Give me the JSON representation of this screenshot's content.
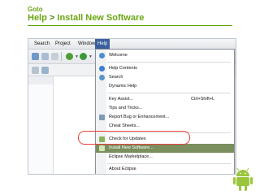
{
  "slide": {
    "kicker": "Goto",
    "title_part1": "Help",
    "title_arrow": ">",
    "title_part2": "Install New Software"
  },
  "menubar": {
    "items": [
      "Search",
      "Project",
      "Window",
      "Help"
    ]
  },
  "help_menu": {
    "items": [
      {
        "label": "Welcome",
        "icon": "welcome-icon"
      },
      {
        "label": "Help Contents",
        "icon": "help-icon"
      },
      {
        "label": "Search",
        "icon": "search-icon"
      },
      {
        "label": "Dynamic Help"
      },
      {
        "label": "Key Assist...",
        "accelerator": "Ctrl+Shift+L"
      },
      {
        "label": "Tips and Tricks..."
      },
      {
        "label": "Report Bug or Enhancement...",
        "icon": "bug-icon"
      },
      {
        "label": "Cheat Sheets..."
      },
      {
        "label": "Check for Updates",
        "icon": "update-icon"
      },
      {
        "label": "Install New Software...",
        "icon": "install-icon",
        "selected": true
      },
      {
        "label": "Eclipse Marketplace..."
      },
      {
        "label": "About Eclipse"
      }
    ]
  },
  "colors": {
    "title_green": "#6aa612",
    "highlight_red": "#e5433c",
    "selection": "#7a8e5e"
  }
}
